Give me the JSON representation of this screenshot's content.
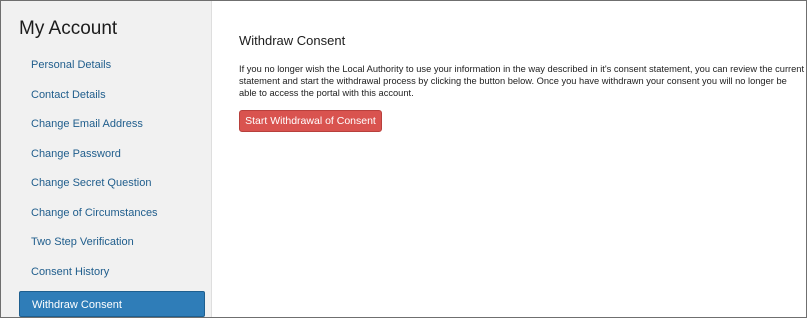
{
  "sidebar": {
    "title": "My Account",
    "items": [
      {
        "label": "Personal Details",
        "active": false
      },
      {
        "label": "Contact Details",
        "active": false
      },
      {
        "label": "Change Email Address",
        "active": false
      },
      {
        "label": "Change Password",
        "active": false
      },
      {
        "label": "Change Secret Question",
        "active": false
      },
      {
        "label": "Change of Circumstances",
        "active": false
      },
      {
        "label": "Two Step Verification",
        "active": false
      },
      {
        "label": "Consent History",
        "active": false
      },
      {
        "label": "Withdraw Consent",
        "active": true
      }
    ]
  },
  "main": {
    "title": "Withdraw Consent",
    "body": "If you no longer wish the Local Authority to use your information in the way described in it's consent statement, you can review the current statement and start the withdrawal process by clicking the button below. Once you have withdrawn your consent you will no longer be able to access the portal with this account.",
    "button_label": "Start Withdrawal of Consent"
  },
  "colors": {
    "link": "#1f5d8c",
    "active_item": "#2f7db8",
    "danger_button": "#d9534f",
    "sidebar_bg": "#f1f1f1"
  }
}
